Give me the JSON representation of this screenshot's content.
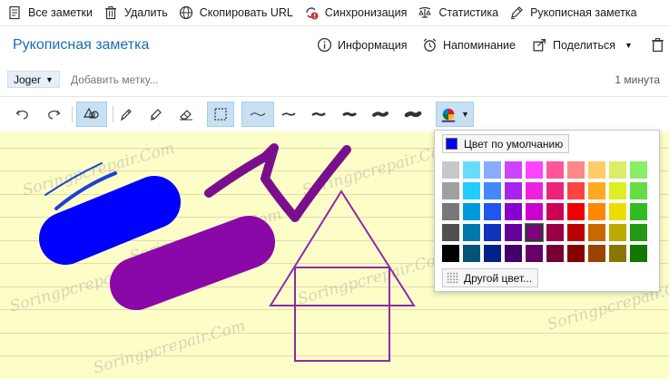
{
  "topbar": {
    "items": [
      {
        "label": "Все заметки",
        "icon": "all-notes-icon"
      },
      {
        "label": "Удалить",
        "icon": "trash-icon"
      },
      {
        "label": "Скопировать URL",
        "icon": "globe-icon"
      },
      {
        "label": "Синхронизация",
        "icon": "sync-error-icon"
      },
      {
        "label": "Статистика",
        "icon": "stats-icon"
      },
      {
        "label": "Рукописная заметка",
        "icon": "pen-icon"
      }
    ]
  },
  "note": {
    "title": "Рукописная заметка",
    "info_label": "Информация",
    "reminder_label": "Напоминание",
    "share_label": "Поделиться",
    "notebook": "Joger",
    "add_tag_placeholder": "Добавить метку...",
    "time_ago": "1 минута"
  },
  "ink_toolbar": {
    "tools": [
      "undo-icon",
      "redo-icon",
      "shapes-icon",
      "pen-icon",
      "highlighter-icon",
      "eraser-icon",
      "lasso-select-icon",
      "stroke-thinnest-icon",
      "stroke-thin-icon",
      "stroke-medium-icon",
      "stroke-thick-icon",
      "stroke-thicker-icon",
      "stroke-thickest-icon",
      "color-palette-icon"
    ],
    "active_tools": [
      "shapes-icon",
      "lasso-select-icon",
      "stroke-thinnest-icon",
      "color-palette-icon"
    ]
  },
  "canvas": {
    "paper_color": "#fdfdc8",
    "watermark": "Soringpcrepair.Com"
  },
  "color_picker": {
    "default_label": "Цвет по умолчанию",
    "default_color": "#0000ff",
    "other_label": "Другой цвет...",
    "selected_color": "#800080",
    "rows": [
      [
        "#c8c8c8",
        "#66ddff",
        "#88aaff",
        "#cc44ff",
        "#ff44ff",
        "#ff5599",
        "#ff8888",
        "#ffcc66",
        "#ddee66",
        "#88ee66"
      ],
      [
        "#a0a0a0",
        "#22ccff",
        "#4488ff",
        "#aa22ee",
        "#ee22dd",
        "#ee2277",
        "#ff4444",
        "#ffaa22",
        "#ddee22",
        "#66dd44"
      ],
      [
        "#787878",
        "#0099dd",
        "#2255ee",
        "#8800cc",
        "#cc00cc",
        "#cc0055",
        "#ee0000",
        "#ff8800",
        "#eedd00",
        "#33bb22"
      ],
      [
        "#505050",
        "#0077aa",
        "#1133bb",
        "#660099",
        "#800080",
        "#990044",
        "#bb0000",
        "#cc6600",
        "#bbaa00",
        "#229911"
      ],
      [
        "#000000",
        "#005577",
        "#002288",
        "#440066",
        "#660066",
        "#770033",
        "#880000",
        "#994400",
        "#887700",
        "#117700"
      ]
    ]
  }
}
